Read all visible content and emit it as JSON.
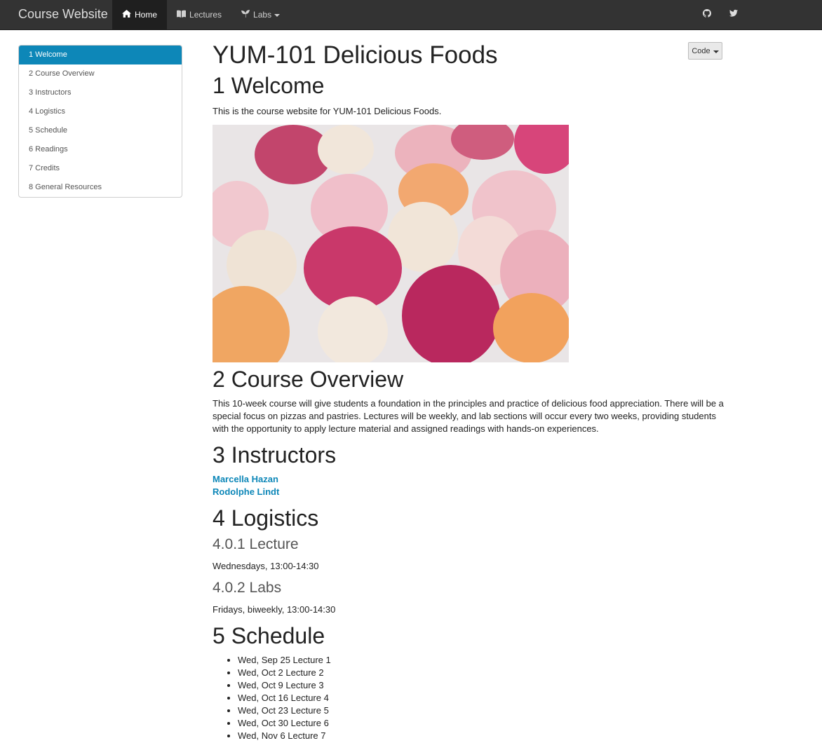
{
  "navbar": {
    "brand": "Course Website",
    "items": [
      {
        "label": "Home",
        "icon": "home-icon",
        "active": true
      },
      {
        "label": "Lectures",
        "icon": "book-icon",
        "active": false
      },
      {
        "label": "Labs",
        "icon": "leaf-icon",
        "active": false,
        "dropdown": true
      }
    ],
    "social": [
      "github-icon",
      "twitter-icon"
    ]
  },
  "toc": {
    "items": [
      {
        "label": "1 Welcome",
        "active": true
      },
      {
        "label": "2 Course Overview"
      },
      {
        "label": "3 Instructors"
      },
      {
        "label": "4 Logistics"
      },
      {
        "label": "5 Schedule"
      },
      {
        "label": "6 Readings"
      },
      {
        "label": "7 Credits"
      },
      {
        "label": "8 General Resources"
      }
    ]
  },
  "code_button": {
    "label": "Code"
  },
  "doc": {
    "title": "YUM-101 Delicious Foods",
    "welcome": {
      "heading": "1 Welcome",
      "text": "This is the course website for YUM-101 Delicious Foods."
    },
    "overview": {
      "heading": "2 Course Overview",
      "text": "This 10-week course will give students a foundation in the principles and practice of delicious food appreciation. There will be a special focus on pizzas and pastries. Lectures will be weekly, and lab sections will occur every two weeks, providing students with the opportunity to apply lecture material and assigned readings with hands-on experiences."
    },
    "instructors": {
      "heading": "3 Instructors",
      "names": [
        "Marcella Hazan",
        "Rodolphe Lindt"
      ]
    },
    "logistics": {
      "heading": "4 Logistics",
      "lecture_heading": "4.0.1 Lecture",
      "lecture_text": "Wednesdays, 13:00-14:30",
      "labs_heading": "4.0.2 Labs",
      "labs_text": "Fridays, biweekly, 13:00-14:30"
    },
    "schedule": {
      "heading": "5 Schedule",
      "items": [
        "Wed, Sep 25 Lecture 1",
        "Wed, Oct 2 Lecture 2",
        "Wed, Oct 9 Lecture 3",
        "Wed, Oct 16 Lecture 4",
        "Wed, Oct 23 Lecture 5",
        "Wed, Oct 30 Lecture 6",
        "Wed, Nov 6 Lecture 7"
      ]
    }
  },
  "colors": {
    "navbar_bg": "#333333",
    "accent": "#0d87b8"
  }
}
